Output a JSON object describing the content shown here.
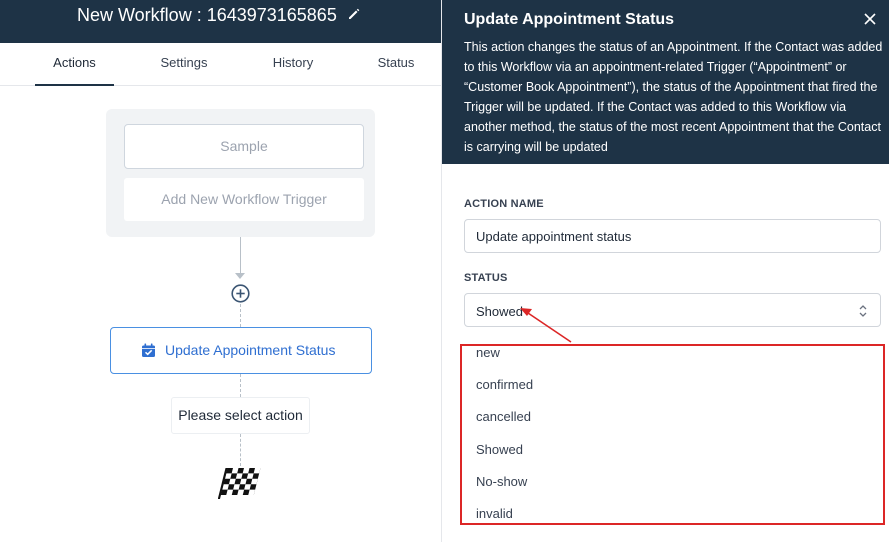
{
  "workflow": {
    "title": "New Workflow : 1643973165865",
    "tabs": [
      {
        "label": "Actions",
        "active": true
      },
      {
        "label": "Settings",
        "active": false
      },
      {
        "label": "History",
        "active": false
      },
      {
        "label": "Status",
        "active": false
      }
    ],
    "trigger": {
      "sample_label": "Sample",
      "add_label": "Add New Workflow Trigger"
    },
    "action_node": {
      "label": "Update Appointment Status",
      "icon": "calendar-check-icon"
    },
    "select_action_label": "Please select action",
    "finish_icon": "checkered-flag-icon"
  },
  "panel": {
    "title": "Update Appointment Status",
    "description": "This action changes the status of an Appointment. If the Contact was added to this Workflow via an appointment-related Trigger (“Appointment” or “Customer Book Appointment”), the status of the Appointment that fired the Trigger will be updated. If the Contact was added to this Workflow via another method, the status of the most recent Appointment that the Contact is carrying will be updated",
    "action_name": {
      "label": "ACTION NAME",
      "value": "Update appointment status"
    },
    "status": {
      "label": "STATUS",
      "selected": "Showed",
      "options": [
        "new",
        "confirmed",
        "cancelled",
        "Showed",
        "No-show",
        "invalid"
      ]
    }
  },
  "colors": {
    "header_bg": "#1e3346",
    "accent_blue": "#4a90e2",
    "highlight_red": "#dc2626"
  }
}
